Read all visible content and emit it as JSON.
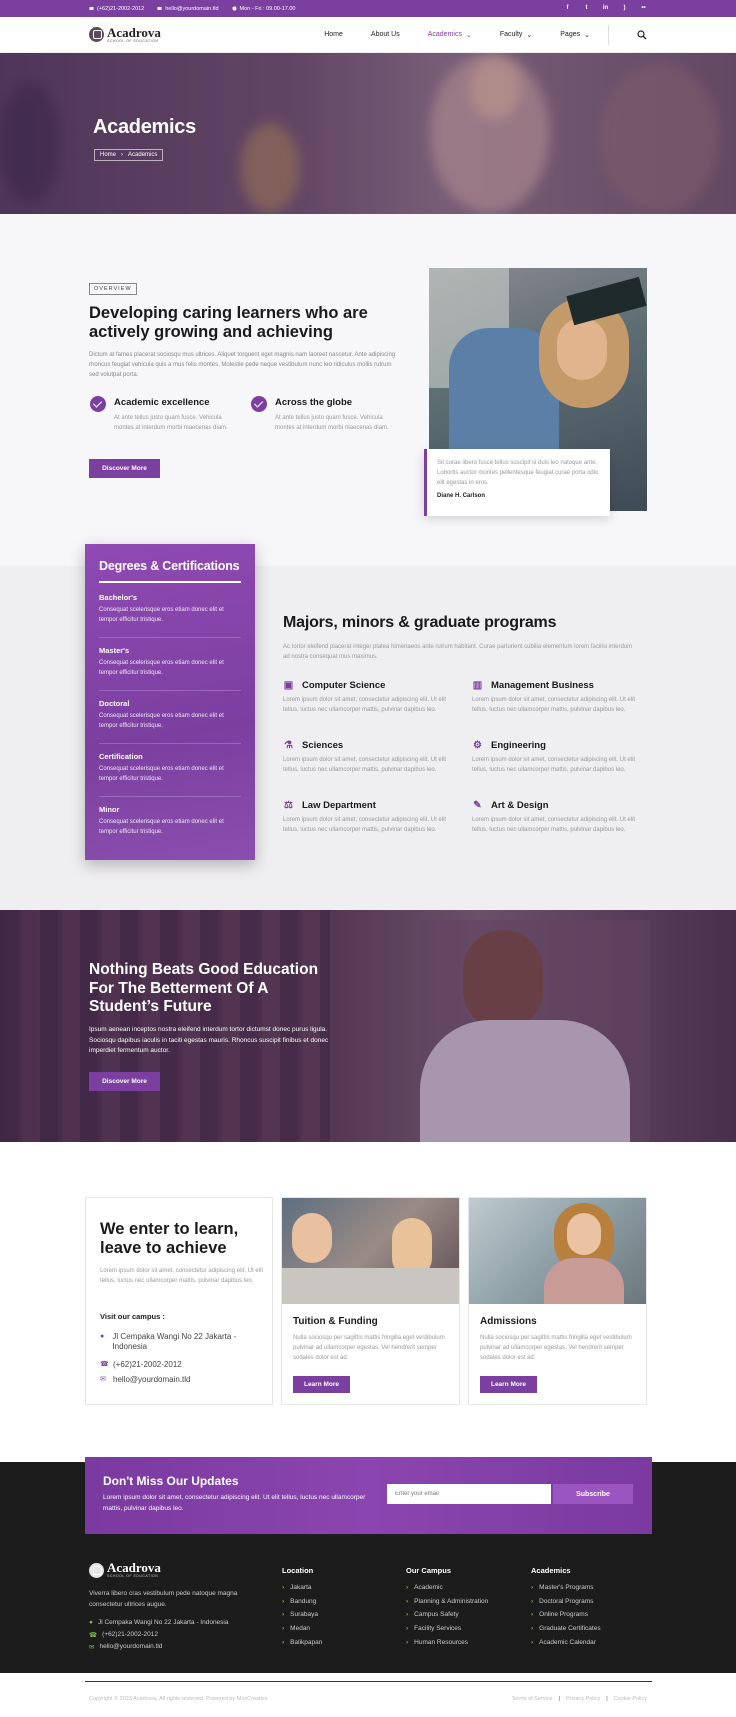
{
  "topbar": {
    "phone": "(+62)21-2002-2012",
    "email": "hello@yourdomain.tld",
    "hours": "Mon - Fri : 09.00-17.00",
    "social": [
      "facebook-icon",
      "twitter-icon",
      "linkedin-icon",
      "rss-icon",
      "flickr-icon"
    ]
  },
  "header": {
    "logo_name": "Acadrova",
    "logo_tagline": "SCHOOL OF EDUCATION",
    "nav": [
      {
        "label": "Home"
      },
      {
        "label": "About Us"
      },
      {
        "label": "Academics",
        "active": true,
        "dropdown": true
      },
      {
        "label": "Faculty",
        "dropdown": true
      },
      {
        "label": "Pages",
        "dropdown": true
      }
    ]
  },
  "hero": {
    "title": "Academics",
    "breadcrumb": [
      "Home",
      "Academics"
    ]
  },
  "overview": {
    "badge": "OVERVIEW",
    "title": "Developing caring learners who are actively growing and achieving",
    "text": "Dictum at fames placerat sociosqu mus ultrices. Aliquet torquent eget magnis nam laoreet nascetur. Ante adipiscing rhoncus feugiat vehicula quis a mus felis montes. Molestie pede neque vestibulum nunc leo ridiculus mollis rutrum sed volutpat porta.",
    "features": [
      {
        "title": "Academic excellence",
        "text": "At ante tellus justo quam fusce. Vehicula montes at interdum morbi maecenas diam."
      },
      {
        "title": "Across the globe",
        "text": "At ante tellus justo quam fusce. Vehicula montes at interdum morbi maecenas diam."
      }
    ],
    "button": "Discover More",
    "quote": {
      "text": "Sit curae libero fusce tellus suscipit si duis leo natoque ante. Lobortis auctor montes pellentesque feugiat curae porta odio elit egestas in eros.",
      "author": "Diane H. Carlson"
    }
  },
  "degrees": {
    "title": "Degrees & Certifications",
    "items": [
      {
        "name": "Bachelor's",
        "text": "Consequat scelerisque eros etiam donec elit et tempor efficitur tristique."
      },
      {
        "name": "Master's",
        "text": "Consequat scelerisque eros etiam donec elit et tempor efficitur tristique."
      },
      {
        "name": "Doctoral",
        "text": "Consequat scelerisque eros etiam donec elit et tempor efficitur tristique."
      },
      {
        "name": "Certification",
        "text": "Consequat scelerisque eros etiam donec elit et tempor efficitur tristique."
      },
      {
        "name": "Minor",
        "text": "Consequat scelerisque eros etiam donec elit et tempor efficitur tristique."
      }
    ]
  },
  "programs": {
    "title": "Majors, minors & graduate programs",
    "text": "Ac tortor eleifend placerat integer platea himenaeos ante rutrum habitant. Curae parturient cubilia elementum lorem facilisi interdum ad nostra consequat mus maximus.",
    "items": [
      {
        "title": "Computer Science",
        "icon": "cpu-icon",
        "text": "Lorem ipsum dolor sit amet, consectetur adipiscing elit. Ut elit tellus, luctus nec ullamcorper mattis, pulvinar dapibus leo."
      },
      {
        "title": "Management Business",
        "icon": "bar-chart-icon",
        "text": "Lorem ipsum dolor sit amet, consectetur adipiscing elit. Ut elit tellus, luctus nec ullamcorper mattis, pulvinar dapibus leo."
      },
      {
        "title": "Sciences",
        "icon": "flask-icon",
        "text": "Lorem ipsum dolor sit amet, consectetur adipiscing elit. Ut elit tellus, luctus nec ullamcorper mattis, pulvinar dapibus leo."
      },
      {
        "title": "Engineering",
        "icon": "gears-icon",
        "text": "Lorem ipsum dolor sit amet, consectetur adipiscing elit. Ut elit tellus, luctus nec ullamcorper mattis, pulvinar dapibus leo."
      },
      {
        "title": "Law Department",
        "icon": "scale-icon",
        "text": "Lorem ipsum dolor sit amet, consectetur adipiscing elit. Ut elit tellus, luctus nec ullamcorper mattis, pulvinar dapibus leo."
      },
      {
        "title": "Art & Design",
        "icon": "palette-icon",
        "text": "Lorem ipsum dolor sit amet, consectetur adipiscing elit. Ut elit tellus, luctus nec ullamcorper mattis, pulvinar dapibus leo."
      }
    ]
  },
  "cta": {
    "title": "Nothing Beats Good Education For The Betterment Of A Student’s Future",
    "text": "Ipsum aenean inceptos nostra eleifend interdum tortor dictumst donec purus ligula. Sociosqu dapibus iaculis in taciti egestas mauris. Rhoncus suscipit finibus et donec imperdiet fermentum auctor.",
    "button": "Discover More"
  },
  "cards": {
    "intro": {
      "title": "We enter to learn, leave to achieve",
      "text": "Lorem ipsum dolor sit amet, consectetur adipiscing elit. Ut elit tellus, luctus nec ullamcorper mattis, pulvinar dapibus leo.",
      "visit_label": "Visit our campus :",
      "address": "Jl Cempaka Wangi No 22 Jakarta - Indonesia",
      "phone": "(+62)21-2002-2012",
      "email": "hello@yourdomain.tld"
    },
    "tuition": {
      "title": "Tuition & Funding",
      "text": "Nulla sociosqu per sagittis mattis fringilla eget vestibulum pulvinar ad ullamcorper egestas. Vel hendrerit semper sodales dolor est ad.",
      "button": "Learn More"
    },
    "admissions": {
      "title": "Admissions",
      "text": "Nulla sociosqu per sagittis mattis fringilla eget vestibulum pulvinar ad ullamcorper egestas. Vel hendrerit semper sodales dolor est ad.",
      "button": "Learn More"
    }
  },
  "newsletter": {
    "title": "Don't Miss Our Updates",
    "text": "Lorem ipsum dolor sit amet, consectetur adipiscing elit. Ut elit tellus, luctus nec ullamcorper mattis, pulvinar dapibus leo.",
    "placeholder": "Enter your email",
    "button": "Subscribe"
  },
  "footer": {
    "description": "Viverra libero cras vestibulum pede natoque magna consectetur ultrices augue.",
    "address": "Jl Cempaka Wangi No 22 Jakarta - Indonesia",
    "phone": "(+62)21-2002-2012",
    "email": "hello@yourdomain.tld",
    "columns": [
      {
        "title": "Location",
        "links": [
          "Jakarta",
          "Bandung",
          "Surabaya",
          "Medan",
          "Balikpapan"
        ]
      },
      {
        "title": "Our Campus",
        "links": [
          "Academic",
          "Planning & Administration",
          "Campus Safety",
          "Facility Services",
          "Human Resources"
        ]
      },
      {
        "title": "Academics",
        "links": [
          "Master's Programs",
          "Doctoral Programs",
          "Online Programs",
          "Graduate Certificates",
          "Academic Calendar"
        ]
      }
    ],
    "copyright": "Copyright © 2023 Acadrova, All rights reserved. Powered by MoxCreative",
    "legal": [
      "Terms of Service",
      "Privacy Policy",
      "Cookie Policy"
    ]
  },
  "colors": {
    "primary": "#7b3fa0",
    "footer_bg": "#1c1c1c",
    "accent_green": "#7fbf4a"
  }
}
